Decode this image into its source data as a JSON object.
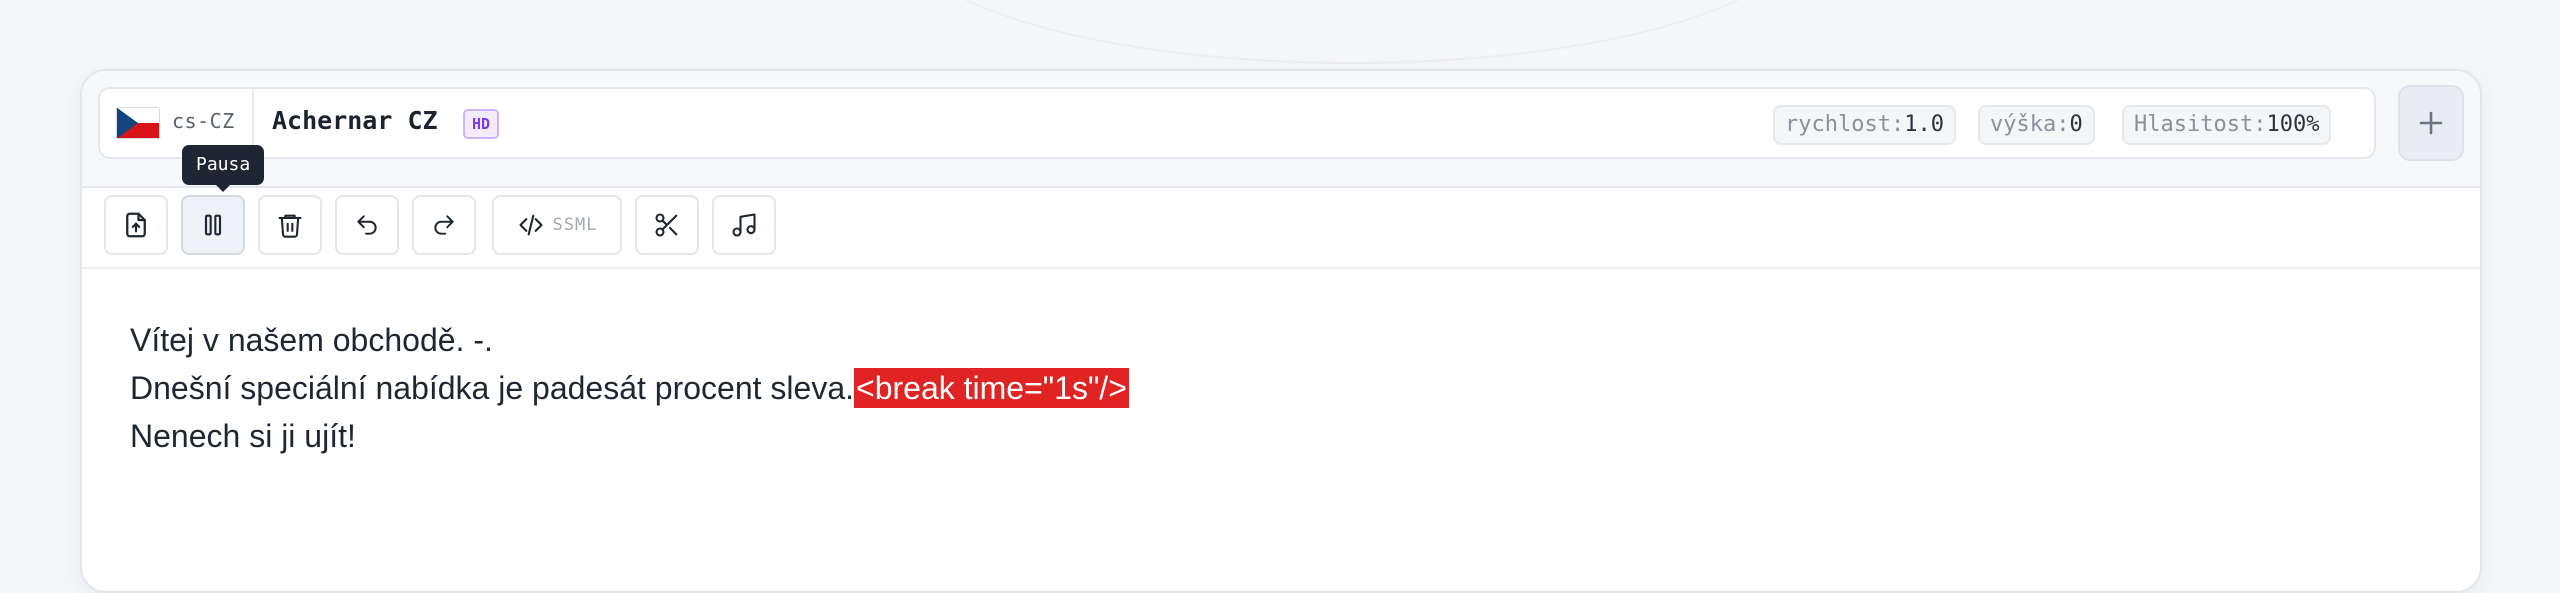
{
  "voice": {
    "lang_code": "cs-CZ",
    "flag": "czech-flag",
    "name": "Achernar CZ",
    "badge": "HD"
  },
  "params": {
    "speed_label": "rychlost:",
    "speed_value": "1.0",
    "pitch_label": "výška:",
    "pitch_value": "0",
    "volume_label": "Hlasitost:",
    "volume_value": "100%"
  },
  "toolbar": {
    "tooltip": "Pausa",
    "ssml_label": "SSML",
    "icons": [
      "upload-file-icon",
      "pause-icon",
      "trash-icon",
      "undo-icon",
      "redo-icon",
      "code-icon",
      "scissors-icon",
      "music-note-icon",
      "plus-icon"
    ]
  },
  "editor": {
    "line1": "Vítej v našem obchodě. -.",
    "line2_text": "Dnešní speciální nabídka je padesát procent sleva.",
    "line2_tag": "<break time=\"1s\"/>",
    "line3": "Nenech si ji ujít!"
  },
  "colors": {
    "accent_purple": "#7c3aed",
    "highlight_red": "#e02424",
    "tooltip_bg": "#1e2633"
  }
}
